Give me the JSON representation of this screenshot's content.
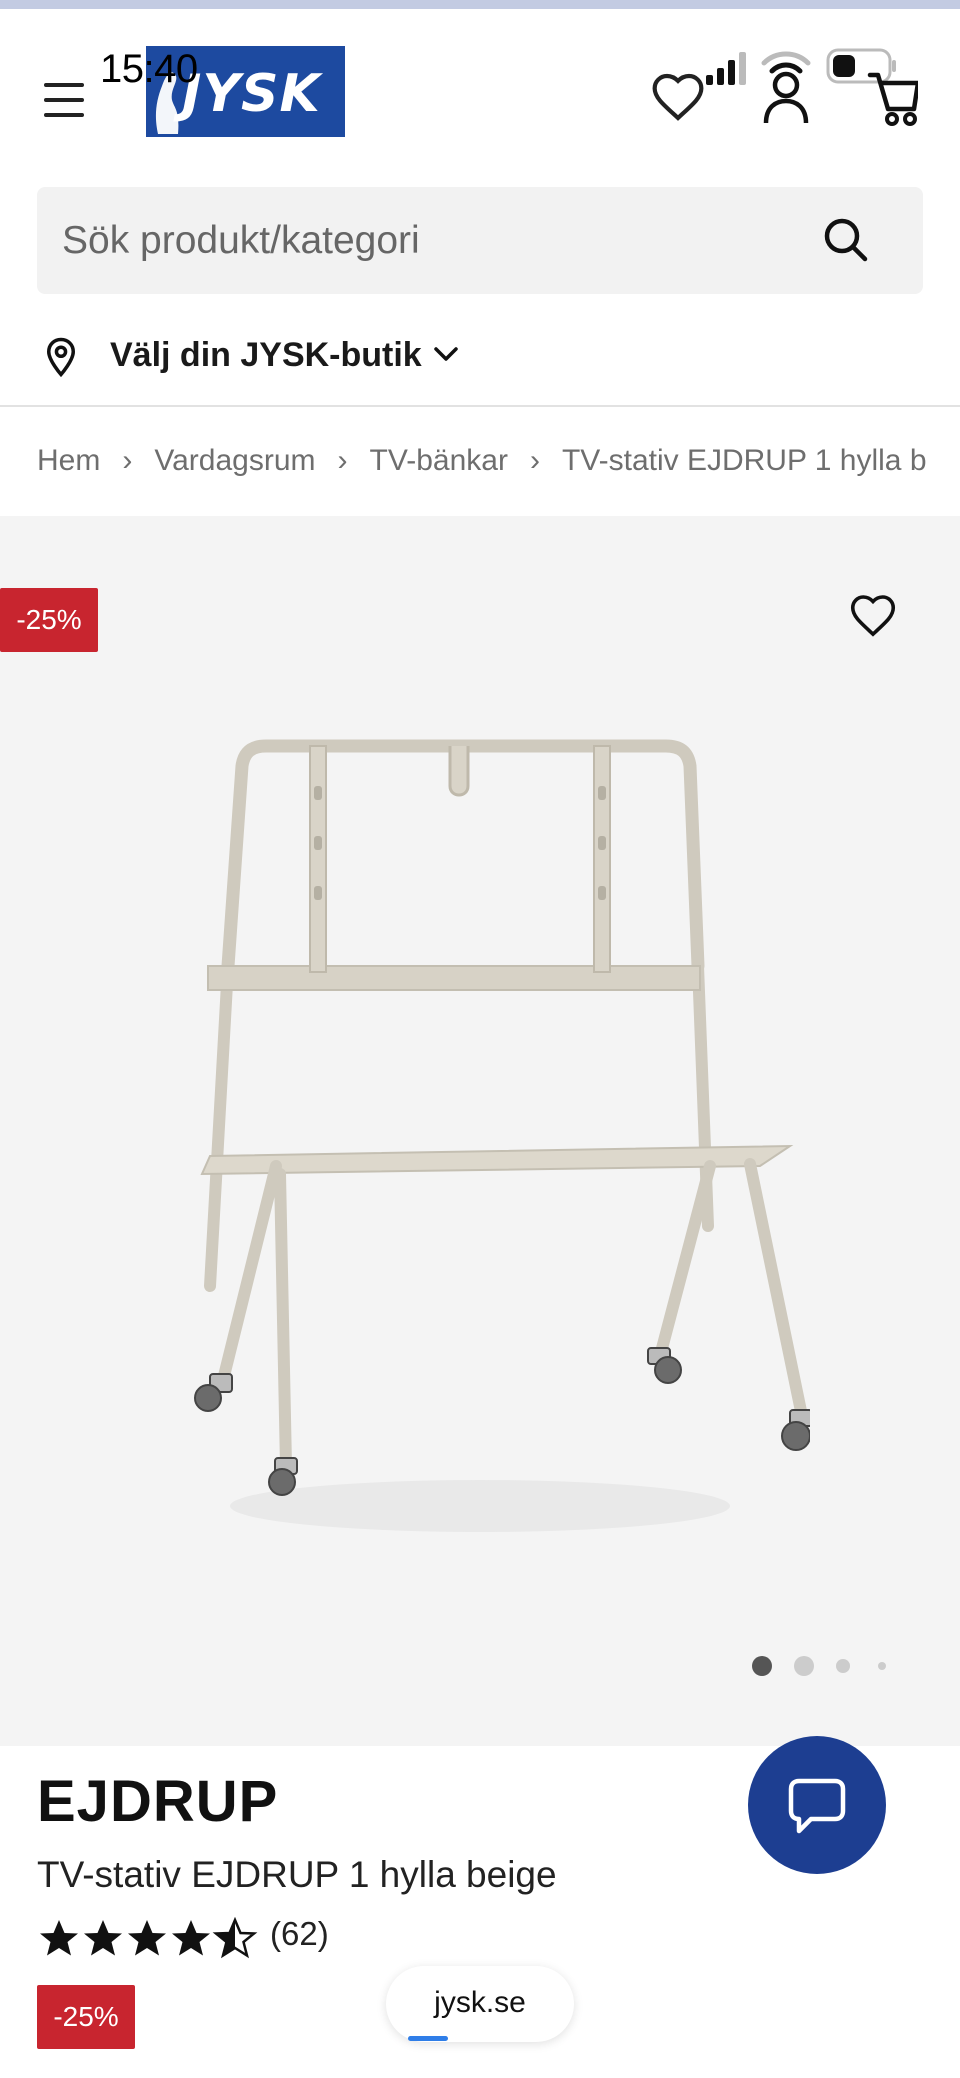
{
  "status_bar": {
    "time": "15:40"
  },
  "header": {
    "logo_text": "JYSK",
    "brand_color": "#1d4aa0"
  },
  "search": {
    "placeholder": "Sök produkt/kategori"
  },
  "store": {
    "label": "Välj din JYSK-butik"
  },
  "breadcrumb": {
    "items": [
      "Hem",
      "Vardagsrum",
      "TV-bänkar",
      "TV-stativ EJDRUP 1 hylla b"
    ]
  },
  "gallery": {
    "discount": "-25%",
    "image_count": 4,
    "active_index": 0
  },
  "product": {
    "brand": "EJDRUP",
    "name": "TV-stativ EJDRUP 1 hylla beige",
    "rating": 4.5,
    "rating_max": 5,
    "review_count": "(62)",
    "discount": "-25%"
  },
  "browser": {
    "url": "jysk.se"
  },
  "colors": {
    "accent_red": "#c8252f",
    "chat_blue": "#1d3e91",
    "stand_beige": "#cfcabe"
  }
}
